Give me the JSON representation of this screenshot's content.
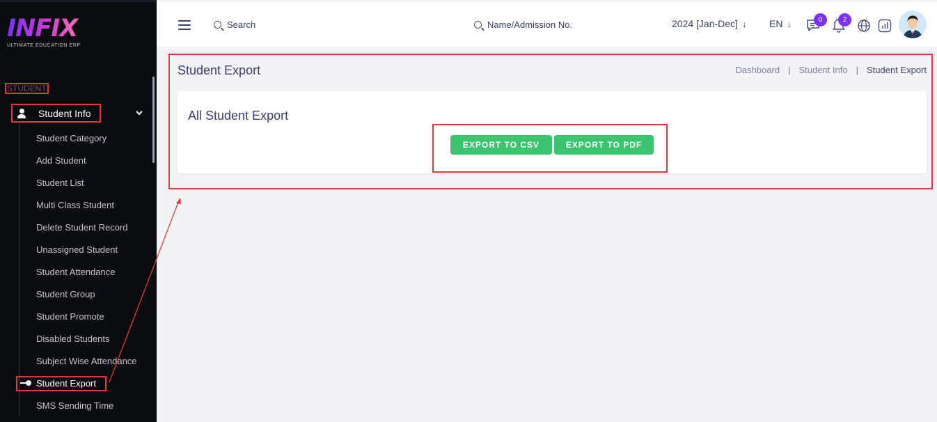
{
  "sidebar": {
    "logo_text": "INFIX",
    "logo_subtitle": "ULTIMATE EDUCATION ERP",
    "section_label": "STUDENT",
    "group_label": "Student Info",
    "items": [
      {
        "label": "Student Category"
      },
      {
        "label": "Add Student"
      },
      {
        "label": "Student List"
      },
      {
        "label": "Multi Class Student"
      },
      {
        "label": "Delete Student Record"
      },
      {
        "label": "Unassigned Student"
      },
      {
        "label": "Student Attendance"
      },
      {
        "label": "Student Group"
      },
      {
        "label": "Student Promote"
      },
      {
        "label": "Disabled Students"
      },
      {
        "label": "Subject Wise Attendance"
      },
      {
        "label": "Student Export"
      },
      {
        "label": "SMS Sending Time"
      }
    ],
    "active_item": "Student Export"
  },
  "header": {
    "search_label": "Search",
    "student_search_label": "Name/Admission No.",
    "academic_year": "2024 [Jan-Dec]",
    "language": "EN",
    "messages_count": "0",
    "notifications_count": "2"
  },
  "page": {
    "title": "Student Export",
    "breadcrumb": [
      "Dashboard",
      "Student Info",
      "Student Export"
    ],
    "card_title": "All Student Export",
    "export_csv_label": "EXPORT TO CSV",
    "export_pdf_label": "EXPORT TO PDF"
  },
  "colors": {
    "sidebar_bg": "#0b0c10",
    "accent": "#7c32ff",
    "button_green": "#3ac46e",
    "annotation_red": "#e03a3a",
    "text_primary": "#3b3f6e"
  }
}
